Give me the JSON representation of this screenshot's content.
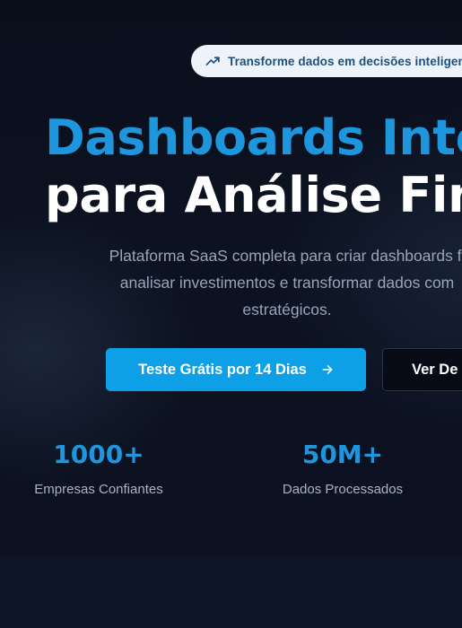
{
  "hero": {
    "badge": {
      "icon": "trending-up-icon",
      "text": "Transforme dados em decisões inteligen"
    },
    "headline": {
      "line1": "Dashboards Inte",
      "line2": "para Análise Fina"
    },
    "subtitle": {
      "line1": "Plataforma SaaS completa para criar dashboards fi",
      "line2": "analisar investimentos e transformar dados com",
      "line3": "estratégicos."
    },
    "cta_primary": {
      "label": "Teste Grátis por 14 Dias",
      "icon": "arrow-right-icon"
    },
    "cta_secondary": {
      "label": "Ver De"
    },
    "stats": [
      {
        "value": "1000+",
        "label": "Empresas Confiantes"
      },
      {
        "value": "50M+",
        "label": "Dados Processados"
      }
    ]
  },
  "colors": {
    "accent": "#1e96dd",
    "button_primary": "#0ea0e6",
    "background": "#0b1020",
    "badge_background": "#eef3fa",
    "badge_text": "#1d4f7a",
    "subtitle_text": "#98a5b8"
  }
}
